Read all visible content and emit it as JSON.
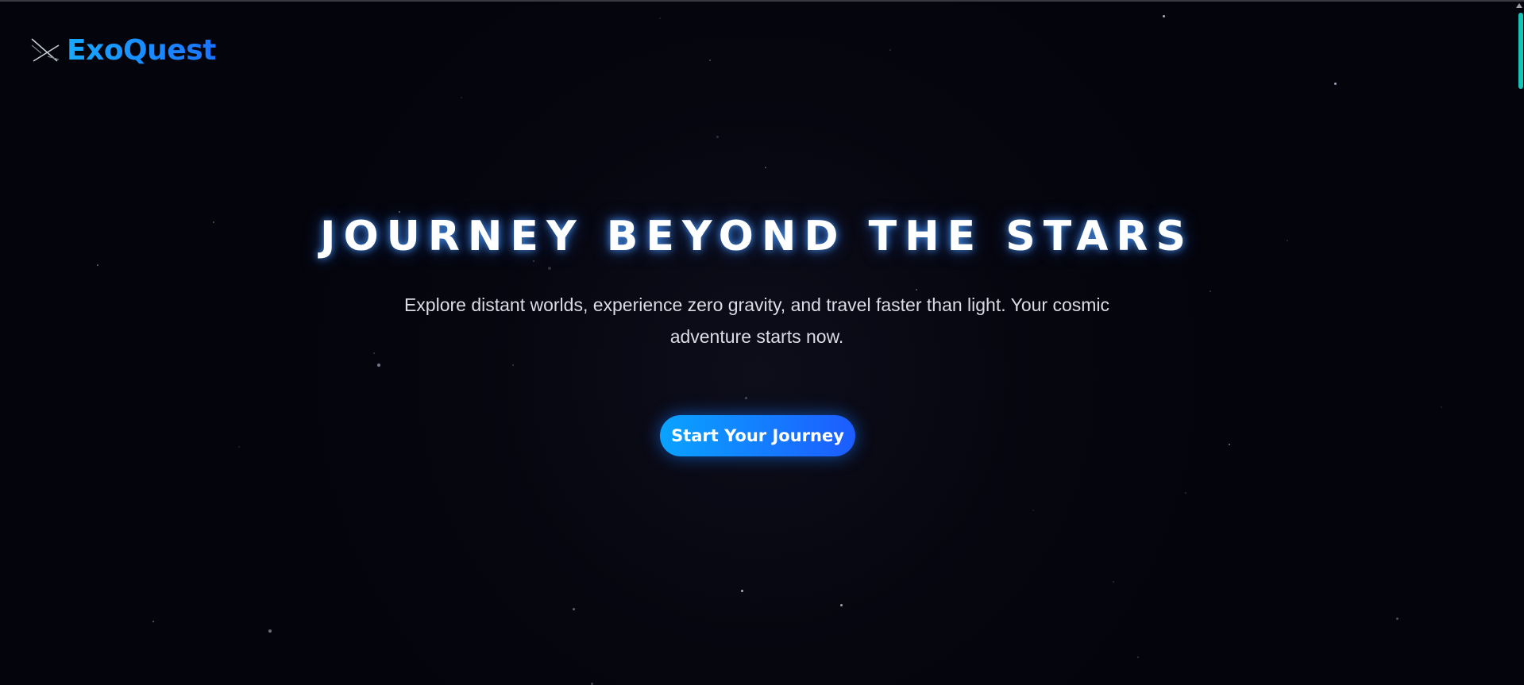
{
  "brand": {
    "name": "ExoQuest",
    "icon": "crossed-spaceship-icon",
    "gradient_colors": [
      "#17a9ff",
      "#1b74ff"
    ]
  },
  "hero": {
    "title": "JOURNEY BEYOND THE STARS",
    "subtitle": "Explore distant worlds, experience zero gravity, and travel faster than light. Your cosmic adventure starts now.",
    "cta_label": "Start Your Journey"
  },
  "theme": {
    "background": "#04040c",
    "accent": "#0aa3ff",
    "accent_end": "#1d5cff",
    "scrollbar": "#17c4b8"
  }
}
